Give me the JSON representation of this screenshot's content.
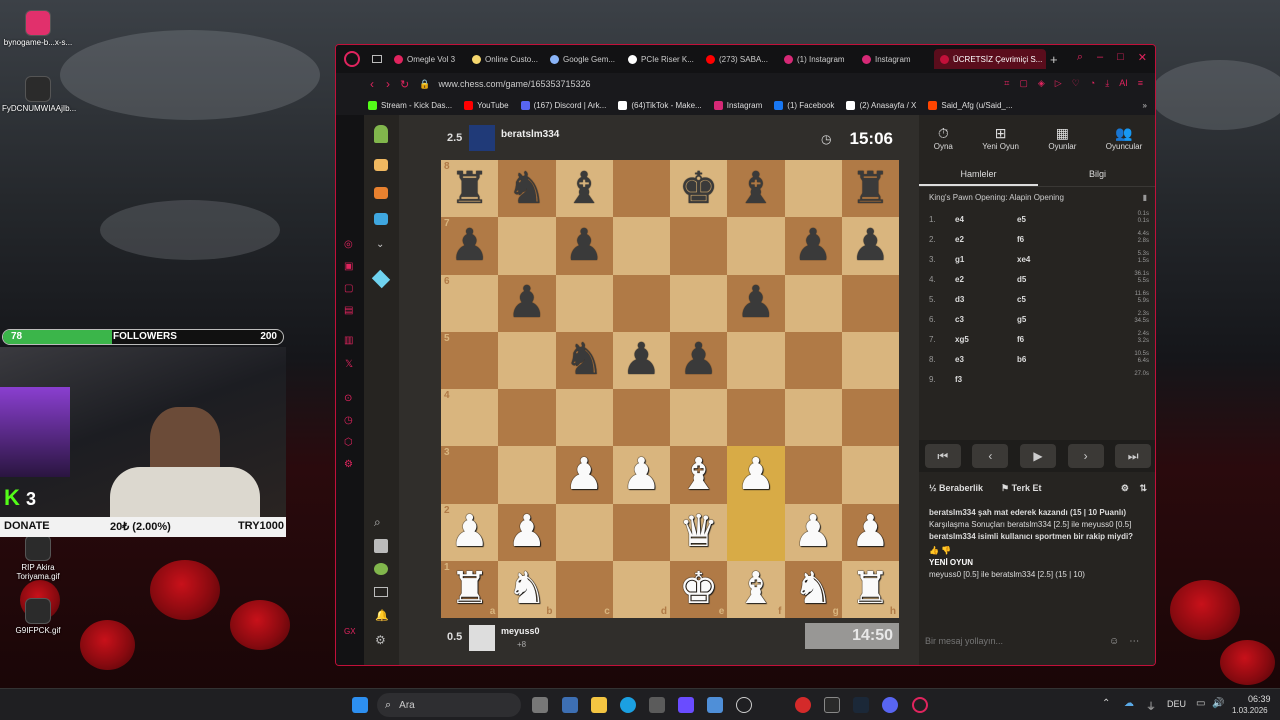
{
  "desktop": {
    "icons": [
      {
        "label": "bynogame-b...x-s..."
      },
      {
        "label": "FyDCNUMWIAAjIb..."
      },
      {
        "label": "RIP Akira Toriyama.gif"
      },
      {
        "label": "G9IFPCK.gif"
      }
    ]
  },
  "stream": {
    "followers_current": "78",
    "followers_label": "FOLLOWERS",
    "followers_goal": "200",
    "followers_progress": 0.39,
    "kick_count": "3",
    "donate_label": "DONATE",
    "donate_amount": "20₺ (2.00%)",
    "donate_goal": "TRY1000"
  },
  "browser": {
    "tabs": [
      {
        "label": "Omegle Vol 3",
        "color": "#e0245e"
      },
      {
        "label": "Online Custo...",
        "color": "#f5d76e"
      },
      {
        "label": "Google Gem...",
        "color": "#8ab4f8"
      },
      {
        "label": "PCIe Riser K...",
        "color": "#ffffff"
      },
      {
        "label": "(273) SABA...",
        "color": "#ff0000"
      },
      {
        "label": "(1) Instagram",
        "color": "#d62976"
      },
      {
        "label": "Instagram",
        "color": "#d62976"
      },
      {
        "label": "ÜCRETSİZ Çevrimiçi S...",
        "color": "#c2103a"
      }
    ],
    "url": "www.chess.com/game/165353715326",
    "bookmarks": [
      {
        "label": "Stream - Kick Das...",
        "color": "#53fc18"
      },
      {
        "label": "YouTube",
        "color": "#ff0000"
      },
      {
        "label": "(167) Discord | Ark...",
        "color": "#5865f2"
      },
      {
        "label": "(64)TikTok - Make...",
        "color": "#ffffff"
      },
      {
        "label": "Instagram",
        "color": "#d62976"
      },
      {
        "label": "(1) Facebook",
        "color": "#1877f2"
      },
      {
        "label": "(2) Anasayfa / X",
        "color": "#ffffff"
      },
      {
        "label": "Said_Afg (u/Said_...",
        "color": "#ff4500"
      }
    ]
  },
  "chess": {
    "opponent": {
      "name": "beratslm334",
      "rating": "2.5",
      "clock": "15:06"
    },
    "player": {
      "name": "meyuss0",
      "rating": "0.5",
      "clock": "14:50",
      "material": "+8"
    },
    "files": [
      "a",
      "b",
      "c",
      "d",
      "e",
      "f",
      "g",
      "h"
    ],
    "ranks": [
      "8",
      "7",
      "6",
      "5",
      "4",
      "3",
      "2",
      "1"
    ],
    "board": [
      [
        "br",
        "bn",
        "bb",
        "",
        "bk",
        "bb",
        "",
        "br"
      ],
      [
        "bp",
        "",
        "bp",
        "",
        "",
        "",
        "bp",
        "bp"
      ],
      [
        "",
        "bp",
        "",
        "",
        "",
        "bp",
        "",
        ""
      ],
      [
        "",
        "",
        "bn",
        "bp",
        "bp",
        "",
        "",
        ""
      ],
      [
        "",
        "",
        "",
        "",
        "",
        "",
        "",
        ""
      ],
      [
        "",
        "",
        "wp",
        "wp",
        "wb",
        "wp",
        "",
        ""
      ],
      [
        "wp",
        "wp",
        "",
        "",
        "wq",
        "",
        "wp",
        "wp"
      ],
      [
        "wr",
        "wn",
        "",
        "",
        "wk",
        "wb",
        "wn",
        "wr"
      ]
    ],
    "highlight": [
      [
        5,
        5
      ],
      [
        6,
        5
      ]
    ],
    "side_tabs": [
      "Oyna",
      "Yeni Oyun",
      "Oyunlar",
      "Oyuncular"
    ],
    "move_tabs": [
      "Hamleler",
      "Bilgi"
    ],
    "opening": "King's Pawn Opening: Alapin Opening",
    "moves": [
      {
        "n": "1.",
        "w": "e4",
        "b": "e5",
        "tw": "0.1s",
        "tb": "0.1s"
      },
      {
        "n": "2.",
        "w": "e2",
        "b": "f6",
        "tw": "4.4s",
        "tb": "2.8s"
      },
      {
        "n": "3.",
        "w": "g1",
        "b": "xe4",
        "tw": "5.3s",
        "tb": "1.5s"
      },
      {
        "n": "4.",
        "w": "e2",
        "b": "d5",
        "tw": "36.1s",
        "tb": "5.5s"
      },
      {
        "n": "5.",
        "w": "d3",
        "b": "c5",
        "tw": "11.6s",
        "tb": "5.9s"
      },
      {
        "n": "6.",
        "w": "c3",
        "b": "g5",
        "tw": "2.3s",
        "tb": "34.5s"
      },
      {
        "n": "7.",
        "w": "xg5",
        "b": "f6",
        "tw": "2.4s",
        "tb": "3.2s"
      },
      {
        "n": "8.",
        "w": "e3",
        "b": "b6",
        "tw": "10.5s",
        "tb": "6.4s"
      },
      {
        "n": "9.",
        "w": "f3",
        "b": "",
        "tw": "27.0s",
        "tb": ""
      }
    ],
    "actions": {
      "draw": "Beraberlik",
      "resign": "Terk Et"
    },
    "chat": [
      "beratslm334 şah mat ederek kazandı (15 | 10 Puanlı)",
      "Karşılaşma Sonuçları beratslm334 [2.5] ile meyuss0 [0.5]",
      "beratslm334 isimli kullanıcı sportmen bir rakip miydi?",
      "YENİ OYUN",
      "meyuss0 [0.5] ile beratslm334 [2.5] (15 | 10)"
    ],
    "chat_placeholder": "Bir mesaj yollayın..."
  },
  "taskbar": {
    "search": "Ara",
    "lang": "DEU",
    "time": "06:39",
    "date": "1.03.2026"
  }
}
